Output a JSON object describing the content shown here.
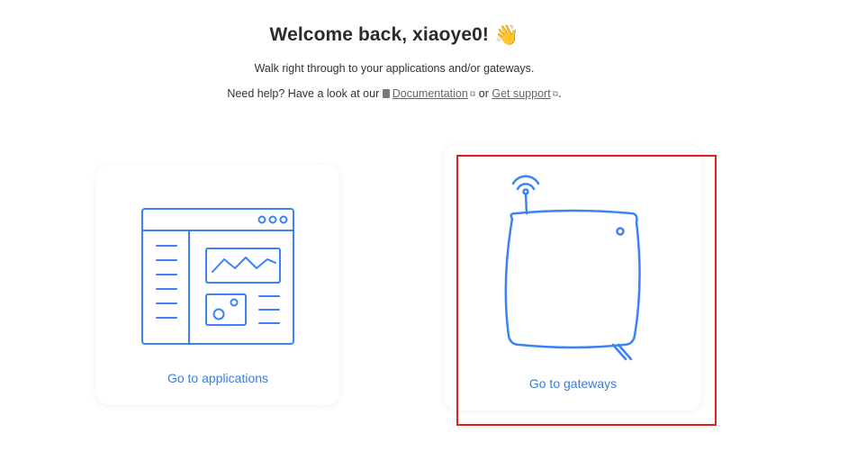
{
  "header": {
    "title": "Welcome back, xiaoye0!",
    "wave_emoji": "👋",
    "subtitle": "Walk right through to your applications and/or gateways.",
    "help_prefix": "Need help? Have a look at our",
    "doc_link": "Documentation",
    "or_text": "or",
    "support_link": "Get support",
    "period": "."
  },
  "cards": {
    "applications": {
      "label": "Go to applications",
      "icon": "application-window-icon"
    },
    "gateways": {
      "label": "Go to gateways",
      "icon": "gateway-device-icon"
    }
  },
  "colors": {
    "accent": "#3a7be0",
    "illustration": "#3b82f6",
    "highlight": "#e0211a"
  }
}
